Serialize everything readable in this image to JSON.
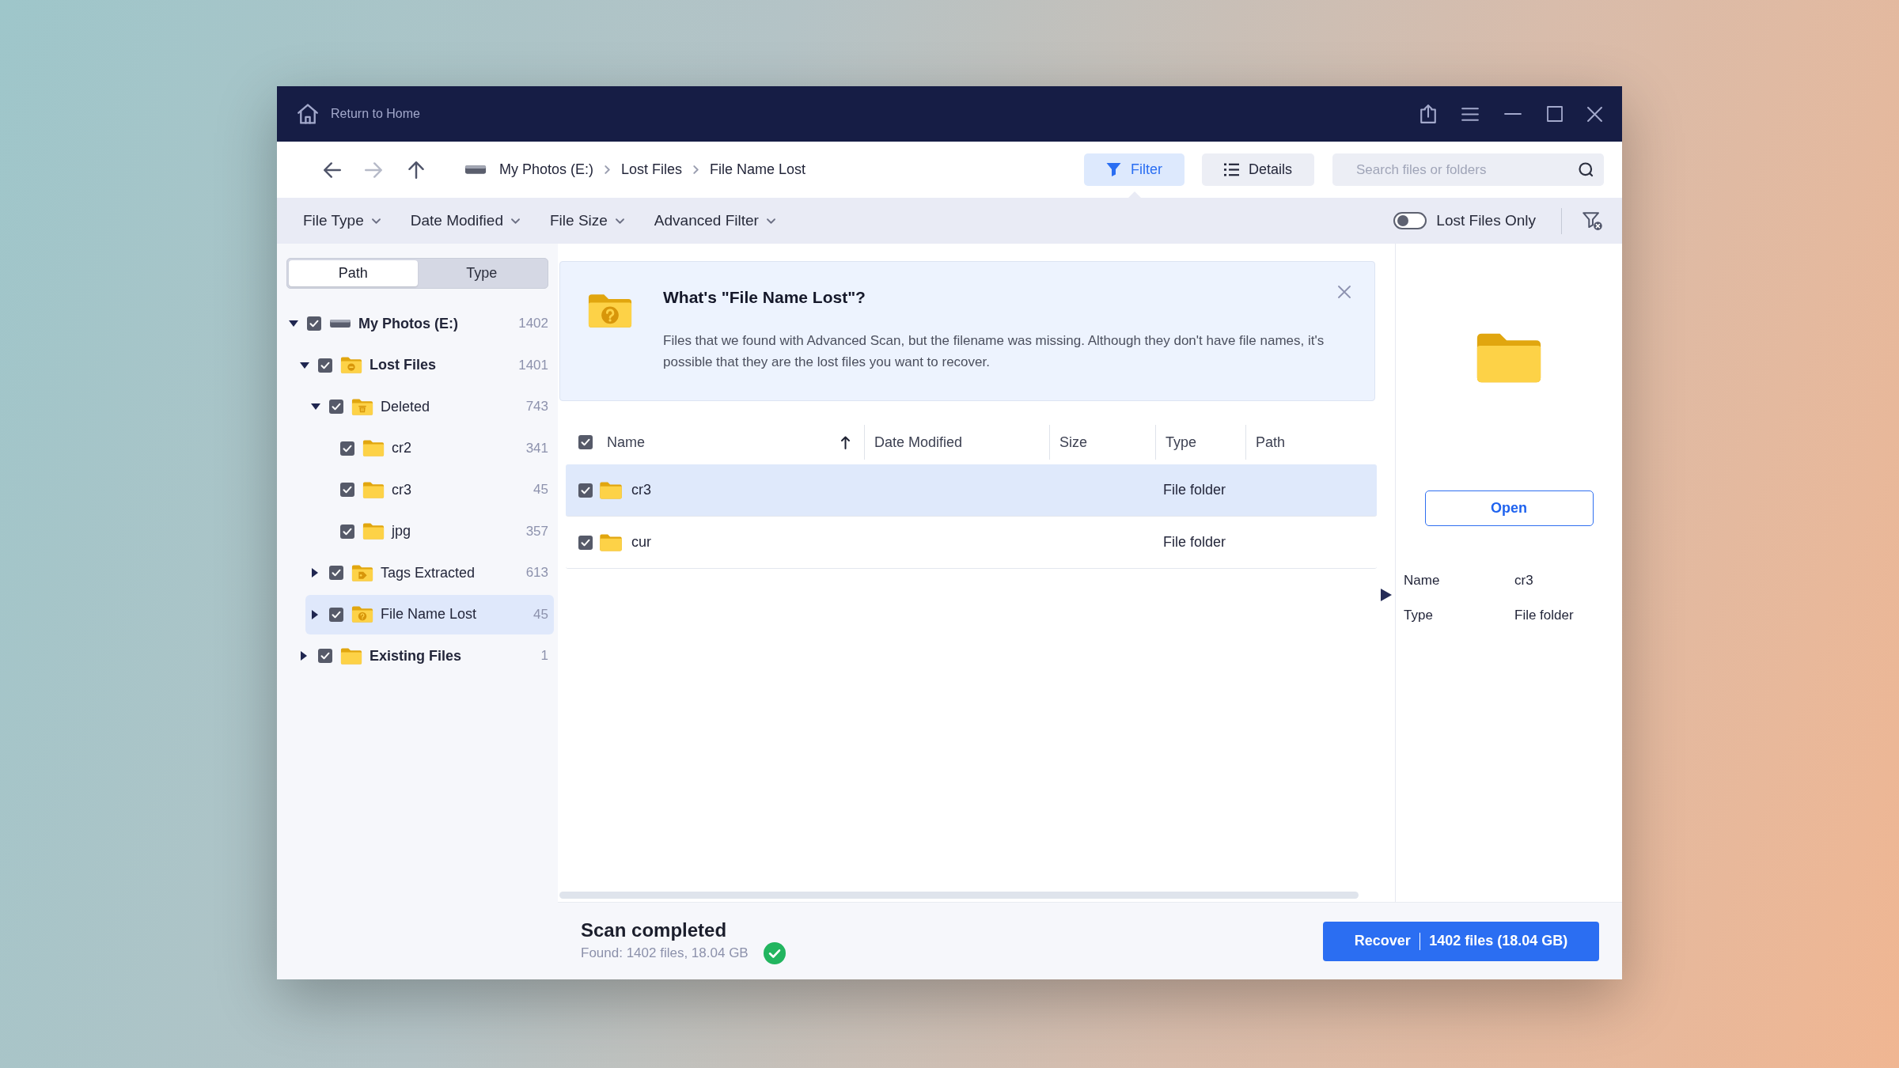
{
  "title_bar": {
    "home_button": "Return to Home"
  },
  "toolbar": {
    "nav": [
      {
        "kind": "back",
        "disabled": false
      },
      {
        "kind": "forward",
        "disabled": true
      },
      {
        "kind": "up",
        "disabled": false
      }
    ],
    "breadcrumb": [
      "My Photos (E:)",
      "Lost Files",
      "File Name Lost"
    ],
    "view_buttons": [
      {
        "kind": "filter",
        "label": "Filter",
        "selected": true
      },
      {
        "kind": "details",
        "label": "Details",
        "selected": false
      }
    ],
    "search": {
      "placeholder": "Search files or folders"
    }
  },
  "filter_bar": {
    "dropdowns": [
      "File Type",
      "Date Modified",
      "File Size",
      "Advanced Filter"
    ],
    "lost_files_only": {
      "label": "Lost Files Only",
      "on": false
    }
  },
  "sidebar": {
    "tabs": [
      {
        "label": "Path",
        "selected": true
      },
      {
        "label": "Type",
        "selected": false
      }
    ],
    "tree": [
      {
        "label": "My Photos (E:)",
        "count": "1402",
        "kind": "drive",
        "checked": true,
        "expanded": true,
        "selected": false,
        "children": [
          {
            "label": "Lost Files",
            "count": "1401",
            "kind": "lost",
            "checked": true,
            "expanded": true,
            "selected": false,
            "children": [
              {
                "label": "Deleted",
                "count": "743",
                "kind": "deleted",
                "checked": true,
                "expanded": true,
                "selected": false,
                "children": [
                  {
                    "label": "cr2",
                    "count": "341",
                    "kind": "folder",
                    "checked": true,
                    "selected": false
                  },
                  {
                    "label": "cr3",
                    "count": "45",
                    "kind": "folder",
                    "checked": true,
                    "selected": false
                  },
                  {
                    "label": "jpg",
                    "count": "357",
                    "kind": "folder",
                    "checked": true,
                    "selected": false
                  }
                ]
              },
              {
                "label": "Tags Extracted",
                "count": "613",
                "kind": "tag",
                "checked": true,
                "expanded": false,
                "selected": false
              },
              {
                "label": "File Name Lost",
                "count": "45",
                "kind": "question",
                "checked": true,
                "expanded": false,
                "selected": true
              }
            ]
          },
          {
            "label": "Existing Files",
            "count": "1",
            "kind": "folder",
            "checked": true,
            "expanded": false,
            "selected": false
          }
        ]
      }
    ]
  },
  "info_banner": {
    "title": "What's \"File Name Lost\"?",
    "text": "Files that we found with Advanced Scan, but the filename was missing. Although they don't have file names, it's possible that they are the lost files you want to recover."
  },
  "table": {
    "all_checked": true,
    "columns": [
      {
        "label": "Name",
        "sorted": true
      },
      {
        "label": "Date Modified",
        "sorted": false
      },
      {
        "label": "Size",
        "sorted": false
      },
      {
        "label": "Type",
        "sorted": false
      },
      {
        "label": "Path",
        "sorted": false
      }
    ],
    "rows": [
      {
        "name": "cr3",
        "type": "File folder",
        "checked": true,
        "selected": true
      },
      {
        "name": "cur",
        "type": "File folder",
        "checked": true,
        "selected": false
      }
    ]
  },
  "details_panel": {
    "button": "Open",
    "fields": [
      {
        "label": "Name",
        "value": "cr3"
      },
      {
        "label": "Type",
        "value": "File folder"
      }
    ]
  },
  "status_bar": {
    "title": "Scan completed",
    "summary": "Found: 1402 files, 18.04 GB",
    "done": true,
    "recover_button": {
      "label": "Recover",
      "detail": "1402 files (18.04 GB)"
    }
  }
}
